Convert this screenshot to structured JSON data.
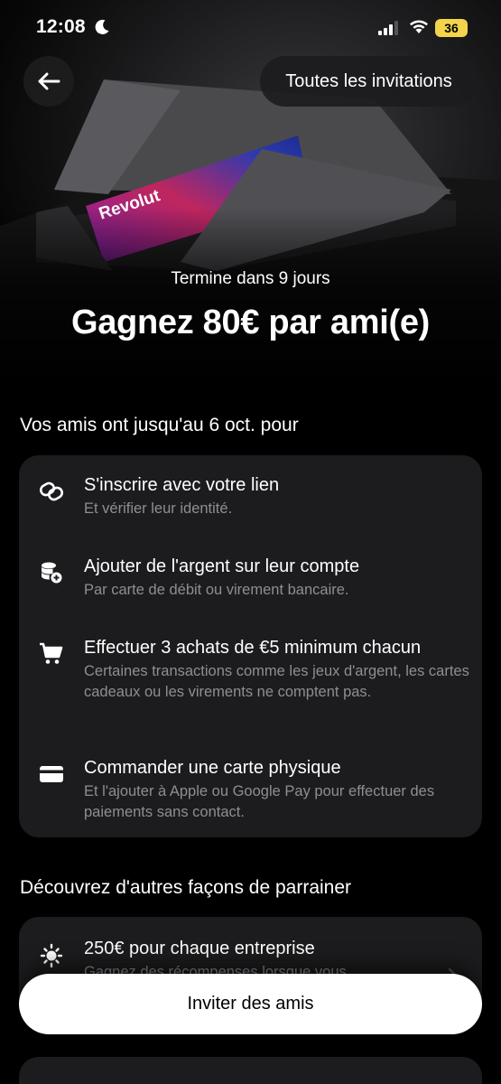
{
  "status_bar": {
    "time": "12:08",
    "battery": "36"
  },
  "header": {
    "invitations_label": "Toutes les invitations"
  },
  "hero": {
    "card_brand": "Revolut",
    "ends_text": "Termine dans 9 jours",
    "headline": "Gagnez 80€ par ami(e)"
  },
  "steps_section": {
    "title": "Vos amis ont jusqu'au 6 oct. pour",
    "steps": [
      {
        "icon": "link-icon",
        "title": "S'inscrire avec votre lien",
        "subtitle": "Et vérifier leur identité."
      },
      {
        "icon": "add-money-icon",
        "title": "Ajouter de l'argent sur leur compte",
        "subtitle": "Par carte de débit ou virement bancaire."
      },
      {
        "icon": "cart-icon",
        "title": "Effectuer 3 achats de €5 minimum chacun",
        "subtitle": "Certaines transactions comme les jeux d'argent, les cartes cadeaux ou les virements ne comptent pas."
      },
      {
        "icon": "card-icon",
        "title": "Commander une carte physique",
        "subtitle": "Et l'ajouter à Apple ou Google Pay pour effectuer des paiements sans contact."
      }
    ]
  },
  "other_section": {
    "title": "Découvrez d'autres façons de parrainer",
    "items": [
      {
        "icon": "sparkle-icon",
        "title": "250€ pour chaque entreprise",
        "subtitle": "Gagnez des récompenses lorsque vous"
      }
    ]
  },
  "cta": {
    "label": "Inviter des amis"
  },
  "colors": {
    "background": "#000000",
    "card": "#1c1c1e",
    "subtitle": "#8e8e93",
    "battery": "#f3d44a"
  }
}
